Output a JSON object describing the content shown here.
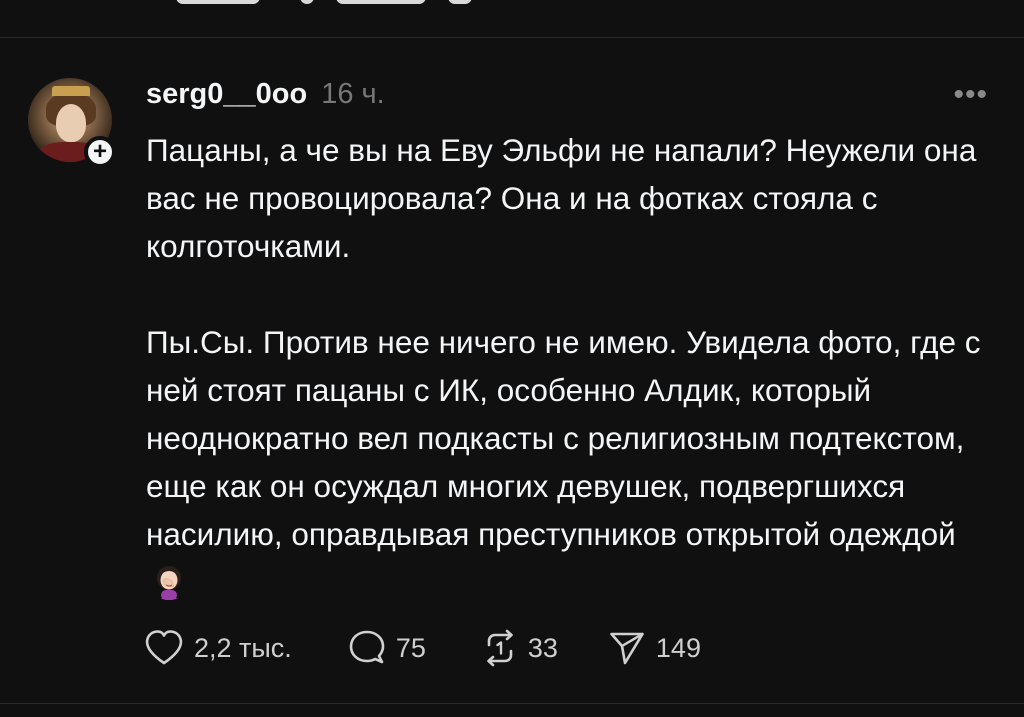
{
  "post": {
    "author": {
      "username": "serg0__0oo",
      "avatar_icon": "avatar",
      "follow_icon": "plus-icon",
      "follow_symbol": "+"
    },
    "time": "16 ч.",
    "more_symbol": "•••",
    "paragraphs": [
      "Пацаны, а че вы на Еву Эльфи не напали? Неужели она вас не провоцировала? Она и на фотках стояла с колготочками.",
      "Пы.Сы. Против нее ничего не имею. Увидела фото, где с ней стоят пацаны с ИК, особенно Алдик, который неоднократно вел подкасты с религиозным подтекстом, еще как он осуждал многих девушек, подвергшихся насилию, оправдывая преступников открытой одеждой"
    ],
    "emoji_icon": "facepalm-woman-emoji",
    "actions": {
      "like": {
        "icon": "heart-icon",
        "count": "2,2 тыс."
      },
      "reply": {
        "icon": "comment-bubble-icon",
        "count": "75"
      },
      "repost": {
        "icon": "repost-icon",
        "count": "33"
      },
      "share": {
        "icon": "send-icon",
        "count": "149"
      }
    }
  },
  "colors": {
    "background": "#101010",
    "text": "#f3f5f7",
    "muted": "#777777",
    "divider": "#2a2a2a"
  }
}
